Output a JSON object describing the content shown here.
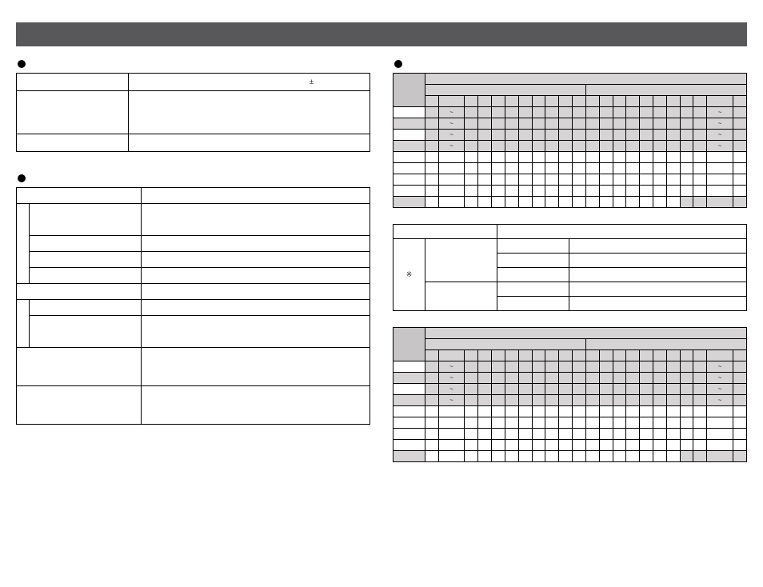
{
  "header": {
    "title": ""
  },
  "left": {
    "section1": {
      "heading": "",
      "rows": [
        {
          "label": "",
          "value": "±"
        },
        {
          "label": "",
          "value": ""
        },
        {
          "label": "",
          "value": ""
        }
      ]
    },
    "section2": {
      "heading": "",
      "groupA": {
        "title": "",
        "rows": [
          {
            "label": "",
            "value": ""
          },
          {
            "label": "",
            "value": ""
          },
          {
            "label": "",
            "value": ""
          },
          {
            "label": "",
            "value": ""
          }
        ]
      },
      "groupB": {
        "title": "",
        "rows": [
          {
            "label": "",
            "value": ""
          },
          {
            "label": "",
            "value": ""
          }
        ]
      },
      "tailRows": [
        {
          "label": "",
          "value": ""
        },
        {
          "label": "",
          "value": ""
        }
      ]
    }
  },
  "right": {
    "heading": "",
    "table1": {
      "topLeft": "",
      "topRight": "",
      "sub": [
        "",
        "",
        "",
        "",
        "",
        "",
        "",
        "",
        "",
        "",
        "",
        "",
        "",
        "",
        "",
        "",
        "",
        "",
        "",
        "",
        "",
        ""
      ],
      "rows": [
        {
          "label": "",
          "left": "~",
          "right": "~"
        },
        {
          "label": "",
          "left": "~",
          "right": "~"
        },
        {
          "label": "",
          "left": "~",
          "right": "~"
        },
        {
          "label": "",
          "left": "~",
          "right": "~"
        }
      ],
      "blankRows": 5
    },
    "table2": {
      "h1": "",
      "h2": "",
      "leftLabel": "※",
      "subRows": [
        {
          "a": "",
          "b": ""
        },
        {
          "a": "",
          "b": ""
        },
        {
          "a": "",
          "b": ""
        },
        {
          "a": "",
          "b": ""
        },
        {
          "a": "",
          "b": ""
        }
      ]
    },
    "table3": {
      "topLeft": "",
      "topRight": "",
      "sub": [
        "",
        "",
        "",
        "",
        "",
        "",
        "",
        "",
        "",
        "",
        "",
        "",
        "",
        "",
        "",
        "",
        "",
        "",
        "",
        "",
        "",
        ""
      ],
      "rows": [
        {
          "label": "",
          "left": "~",
          "right": "~"
        },
        {
          "label": "",
          "left": "~",
          "right": "~"
        },
        {
          "label": "",
          "left": "~",
          "right": "~"
        },
        {
          "label": "",
          "left": "~",
          "right": "~"
        }
      ],
      "blankRows": 5
    }
  }
}
